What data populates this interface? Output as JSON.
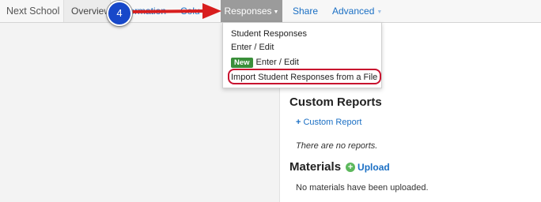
{
  "nav": {
    "school": "Next School",
    "overview": "Overview",
    "information": "formation",
    "columns": "Colu",
    "responses": "Responses",
    "share": "Share",
    "advanced": "Advanced"
  },
  "dropdown": {
    "items": [
      {
        "label": "Student Responses"
      },
      {
        "label": "Enter / Edit"
      },
      {
        "badge": "New",
        "label": "Enter / Edit"
      },
      {
        "label": "Import Student Responses from a File"
      }
    ]
  },
  "callout": {
    "step": "4"
  },
  "reports": {
    "title": "Custom Reports",
    "add_plus": "+",
    "add_label": "Custom Report",
    "empty": "There are no reports."
  },
  "materials": {
    "title": "Materials",
    "upload_icon": "+",
    "upload_label": "Upload",
    "empty": "No materials have been uploaded."
  },
  "colors": {
    "link": "#1a6fc4",
    "active_tab": "#9b9b9b",
    "highlight": "#c8102e",
    "callout": "#1748c9",
    "badge": "#3a8f3a"
  },
  "icons": {
    "arrow": "red-right-arrow-icon",
    "caret": "caret-down-icon",
    "upload": "plus-circle-icon"
  }
}
